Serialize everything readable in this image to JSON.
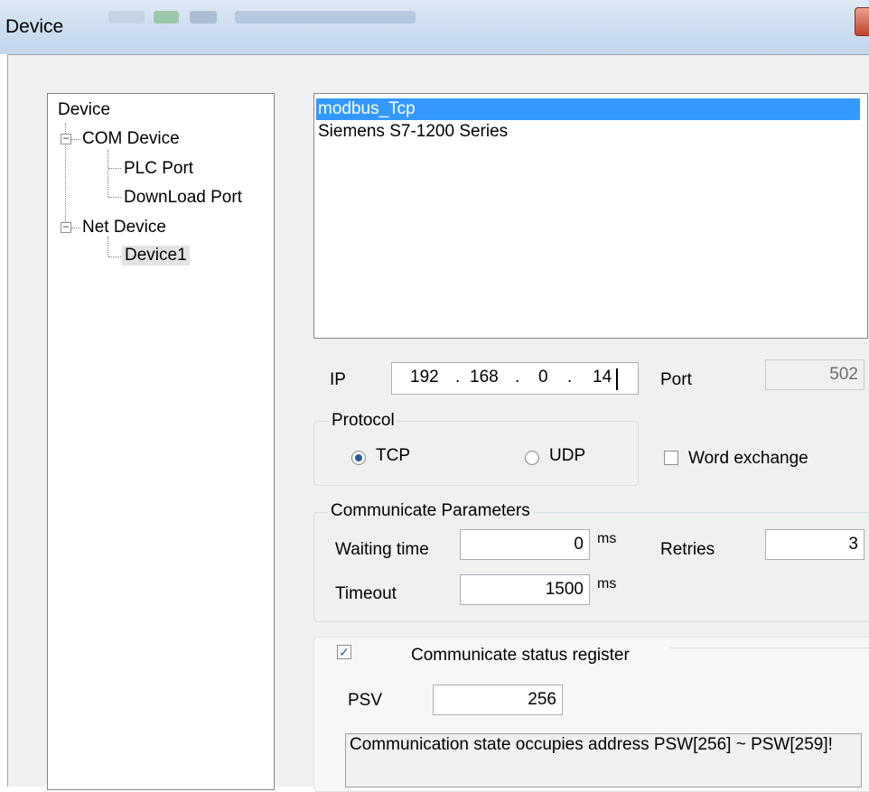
{
  "window": {
    "title": "Device"
  },
  "tree": {
    "root": "Device",
    "com_group": "COM Device",
    "com_children": [
      "PLC Port",
      "DownLoad Port"
    ],
    "net_group": "Net Device",
    "net_children": [
      "Device1"
    ],
    "expander_symbol": "−"
  },
  "device_list": {
    "items": [
      "modbus_Tcp",
      "Siemens S7-1200 Series"
    ],
    "selected": "modbus_Tcp"
  },
  "ip": {
    "label": "IP",
    "octets": [
      "192",
      "168",
      "0",
      "14"
    ],
    "dot": "."
  },
  "port": {
    "label": "Port",
    "value": "502"
  },
  "protocol": {
    "title": "Protocol",
    "options": [
      "TCP",
      "UDP"
    ],
    "selected": "TCP"
  },
  "word_exchange": {
    "label": "Word exchange",
    "checked": false
  },
  "comm_params": {
    "title": "Communicate Parameters",
    "waiting_label": "Waiting time",
    "waiting_value": "0",
    "waiting_unit": "ms",
    "retries_label": "Retries",
    "retries_value": "3",
    "timeout_label": "Timeout",
    "timeout_value": "1500",
    "timeout_unit": "ms"
  },
  "status_register": {
    "label": "Communicate status register",
    "checked": true,
    "check_glyph": "✓",
    "psv_label": "PSV",
    "psv_value": "256",
    "info": "Communication state occupies address PSW[256] ~ PSW[259]!"
  },
  "colors": {
    "selection": "#3399ff",
    "titlebar": "#cfdff0",
    "close": "#c0432d"
  }
}
